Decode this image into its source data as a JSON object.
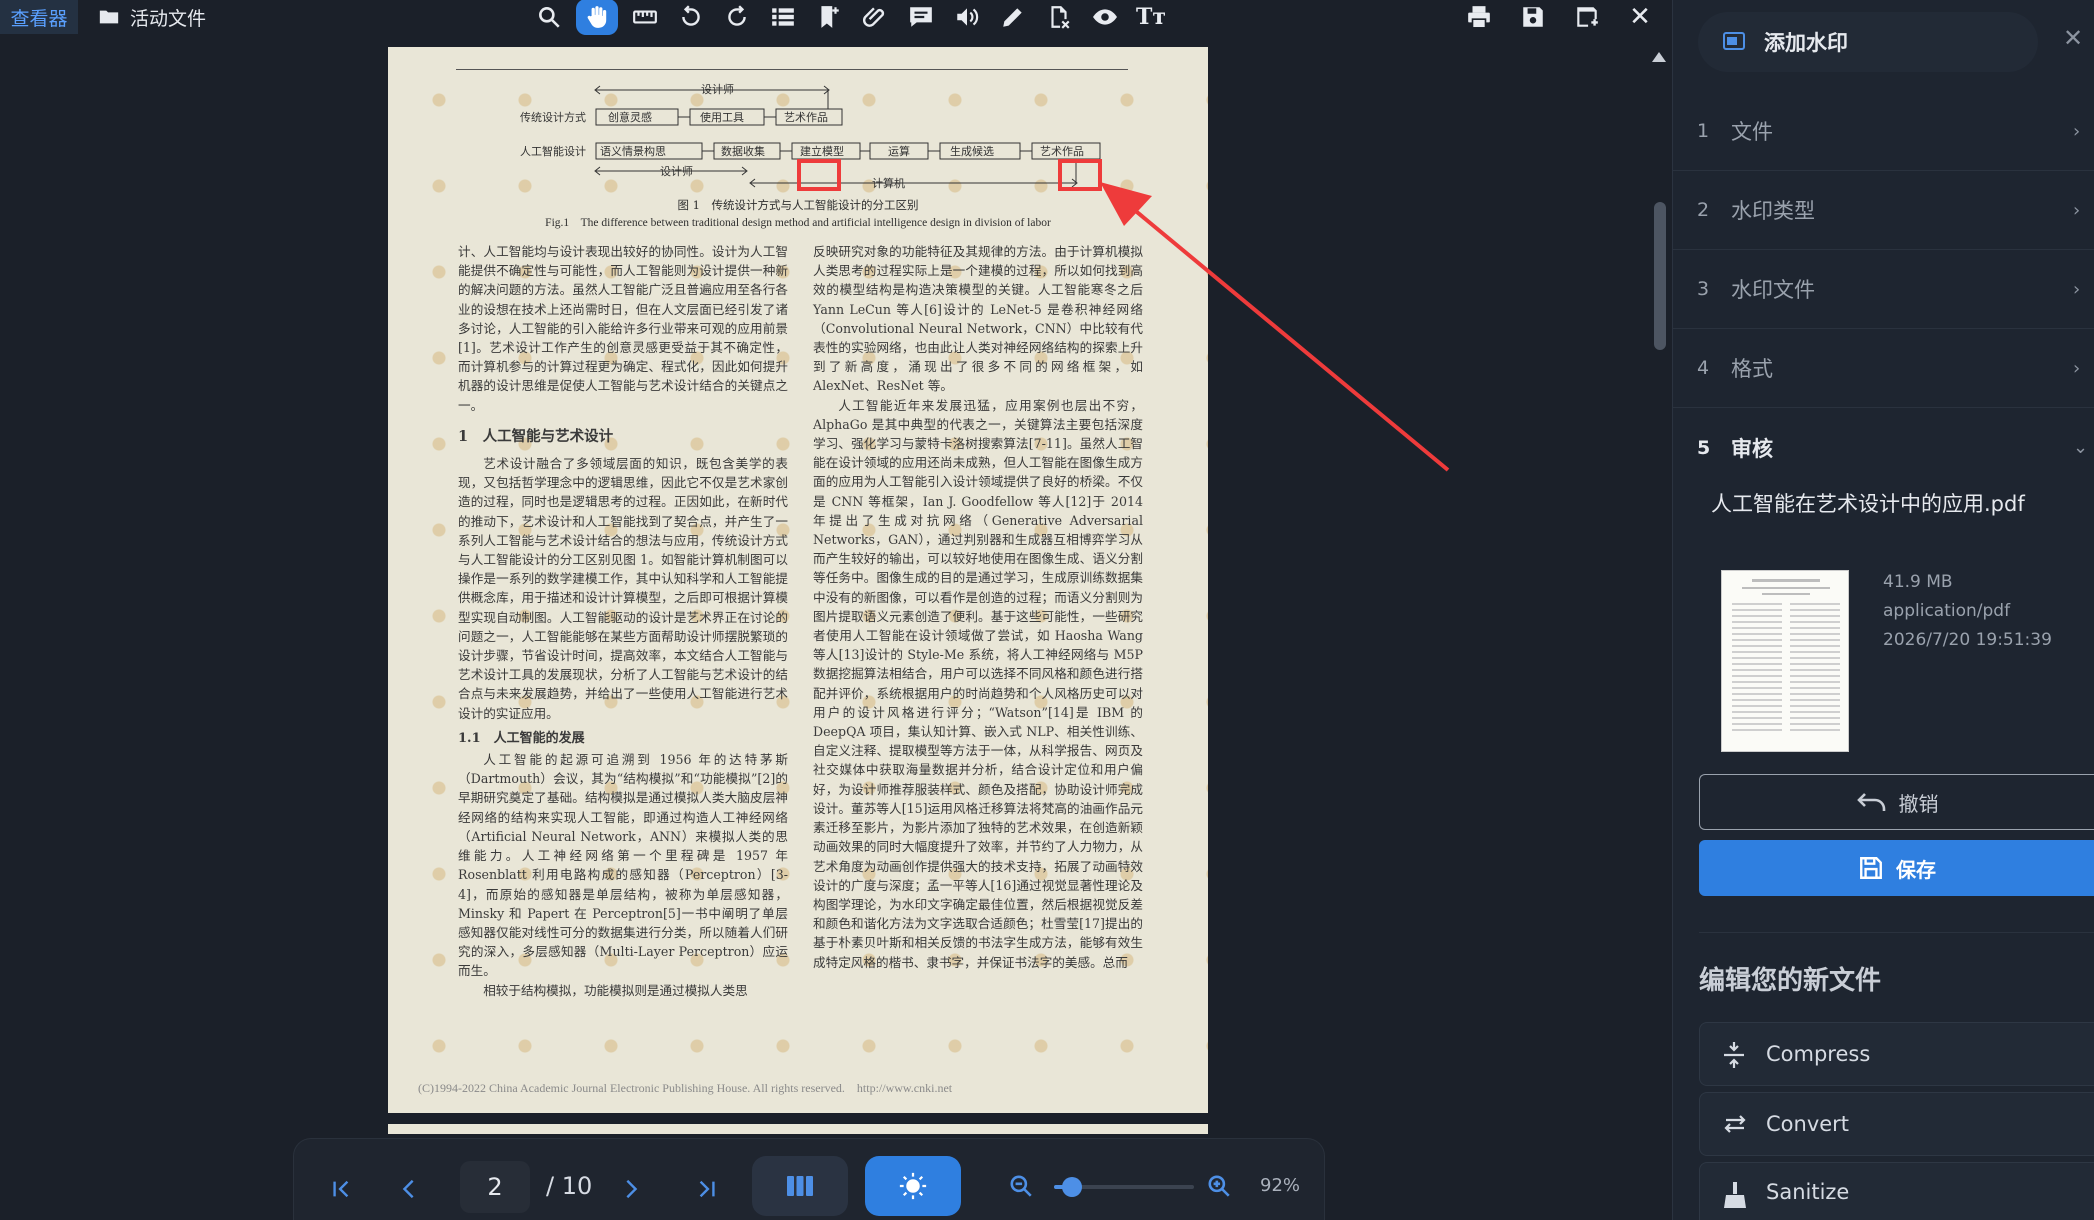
{
  "topbar": {
    "viewer_tab": "查看器",
    "active_files_tab": "活动文件"
  },
  "document": {
    "diagram": {
      "designer_top": "设计师",
      "trad_row_label": "传统设计方式",
      "trad_boxes": [
        "创意灵感",
        "使用工具",
        "艺术作品"
      ],
      "ai_row_label": "人工智能设计",
      "ai_boxes": [
        "语义情景构思",
        "数据收集",
        "建立模型",
        "运算",
        "生成候选",
        "艺术作品"
      ],
      "designer_bottom": "设计师",
      "computer": "计算机"
    },
    "fig_caption_cn": "图 1　传统设计方式与人工智能设计的分工区别",
    "fig_caption_en": "Fig.1　The difference between traditional design method and artificial intelligence design in division of labor",
    "left_col_p1": "计、人工智能均与设计表现出较好的协同性。设计为人工智能提供不确定性与可能性，而人工智能则为设计提供一种新的解决问题的方法。虽然人工智能广泛且普遍应用至各行各业的设想在技术上还尚需时日，但在人文层面已经引发了诸多讨论，人工智能的引入能给许多行业带来可观的应用前景[1]。艺术设计工作产生的创意灵感更受益于其不确定性，而计算机参与的计算过程更为确定、程式化，因此如何提升机器的设计思维是促使人工智能与艺术设计结合的关键点之一。",
    "section1_title": "1　人工智能与艺术设计",
    "left_col_p2": "艺术设计融合了多领域层面的知识，既包含美学的表现，又包括哲学理念中的逻辑思维，因此它不仅是艺术家创造的过程，同时也是逻辑思考的过程。正因如此，在新时代的推动下，艺术设计和人工智能找到了契合点，并产生了一系列人工智能与艺术设计结合的想法与应用，传统设计方式与人工智能设计的分工区别见图 1。如智能计算机制图可以操作是一系列的数学建模工作，其中认知科学和人工智能提供概念库，用于描述和设计计算模型，之后即可根据计算模型实现自动制图。人工智能驱动的设计是艺术界正在讨论的问题之一，人工智能能够在某些方面帮助设计师摆脱繁琐的设计步骤，节省设计时间，提高效率，本文结合人工智能与艺术设计工具的发展现状，分析了人工智能与艺术设计的结合点与未来发展趋势，并给出了一些使用人工智能进行艺术设计的实证应用。",
    "section11_title": "1.1　人工智能的发展",
    "left_col_p3": "人工智能的起源可追溯到 1956 年的达特茅斯（Dartmouth）会议，其为“结构模拟”和“功能模拟”[2]的早期研究奠定了基础。结构模拟是通过模拟人类大脑皮层神经网络的结构来实现人工智能，即通过构造人工神经网络（Artificial Neural Network，ANN）来模拟人类的思维能力。人工神经网络第一个里程碑是 1957 年 Rosenblatt 利用电路构成的感知器（Perceptron）[3-4]，而原始的感知器是单层结构，被称为单层感知器，Minsky 和 Papert 在 Perceptron[5]一书中阐明了单层感知器仅能对线性可分的数据集进行分类，所以随着人们研究的深入，多层感知器（Multi-Layer Perceptron）应运而生。",
    "left_col_p4": "相较于结构模拟，功能模拟则是通过模拟人类思",
    "right_col_p1": "反映研究对象的功能特征及其规律的方法。由于计算机模拟人类思考的过程实际上是一个建模的过程，所以如何找到高效的模型结构是构造决策模型的关键。人工智能寒冬之后 Yann LeCun 等人[6]设计的 LeNet-5 是卷积神经网络（Convolutional Neural Network，CNN）中比较有代表性的实验网络，也由此让人类对神经网络结构的探索上升到了新高度，涌现出了很多不同的网络框架，如 AlexNet、ResNet 等。",
    "right_col_p2": "人工智能近年来发展迅猛，应用案例也层出不穷，AlphaGo 是其中典型的代表之一，关键算法主要包括深度学习、强化学习与蒙特卡洛树搜索算法[7-11]。虽然人工智能在设计领域的应用还尚未成熟，但人工智能在图像生成方面的应用为人工智能引入设计领域提供了良好的桥梁。不仅是 CNN 等框架，Ian J. Goodfellow 等人[12]于 2014 年提出了生成对抗网络（Generative Adversarial Networks，GAN），通过判别器和生成器互相博弈学习从而产生较好的输出，可以较好地使用在图像生成、语义分割等任务中。图像生成的目的是通过学习，生成原训练数据集中没有的新图像，可以看作是创造的过程；而语义分割则为图片提取语义元素创造了便利。基于这些可能性，一些研究者使用人工智能在设计领域做了尝试，如 Haosha Wang 等人[13]设计的 Style-Me 系统，将人工神经网络与 M5P 数据挖掘算法相结合，用户可以选择不同风格和颜色进行搭配并评价，系统根据用户的时尚趋势和个人风格历史可以对用户的设计风格进行评分；“Watson”[14]是 IBM 的 DeepQA 项目，集认知计算、嵌入式 NLP、相关性训练、自定义注释、提取模型等方法于一体，从科学报告、网页及社交媒体中获取海量数据并分析，结合设计定位和用户偏好，为设计师推荐服装样式、颜色及搭配，协助设计师完成设计。董苏等人[15]运用风格迁移算法将梵高的油画作品元素迁移至影片，为影片添加了独特的艺术效果，在创造新颖动画效果的同时大幅度提升了效率，并节约了人力物力，从艺术角度为动画创作提供强大的技术支持，拓展了动画特效设计的广度与深度；孟一平等人[16]通过视觉显著性理论及构图学理论，为水印文字确定最佳位置，然后根据视觉反差和颜色和谐化方法为文字选取合适颜色；杜雪莹[17]提出的基于朴素贝叶斯和相关反馈的书法字生成方法，能够有效生成特定风格的楷书、隶书字，并保证书法字的美感。总而",
    "footer_copyright": "(C)1994-2022 China Academic Journal Electronic Publishing House. All rights reserved.　http://www.cnki.net"
  },
  "navigation": {
    "current_page": "2",
    "total_pages": "/ 10",
    "zoom_level": "92%",
    "zoom_fraction": 0.13
  },
  "sidebar": {
    "title": "添加水印",
    "steps": [
      {
        "num": "1",
        "label": "文件"
      },
      {
        "num": "2",
        "label": "水印类型"
      },
      {
        "num": "3",
        "label": "水印文件"
      },
      {
        "num": "4",
        "label": "格式"
      },
      {
        "num": "5",
        "label": "审核"
      }
    ],
    "file_name": "人工智能在艺术设计中的应用.pdf",
    "file_size": "41.9 MB",
    "file_type": "application/pdf",
    "file_date": "2026/7/20 19:51:39",
    "undo_label": "撤销",
    "save_label": "保存",
    "edit_title": "编辑您的新文件",
    "tools": [
      {
        "label": "Compress"
      },
      {
        "label": "Convert"
      },
      {
        "label": "Sanitize"
      }
    ]
  },
  "colors": {
    "accent": "#2f7fe0",
    "annotation": "#ee3b3b",
    "page": "#e9e6d7"
  }
}
